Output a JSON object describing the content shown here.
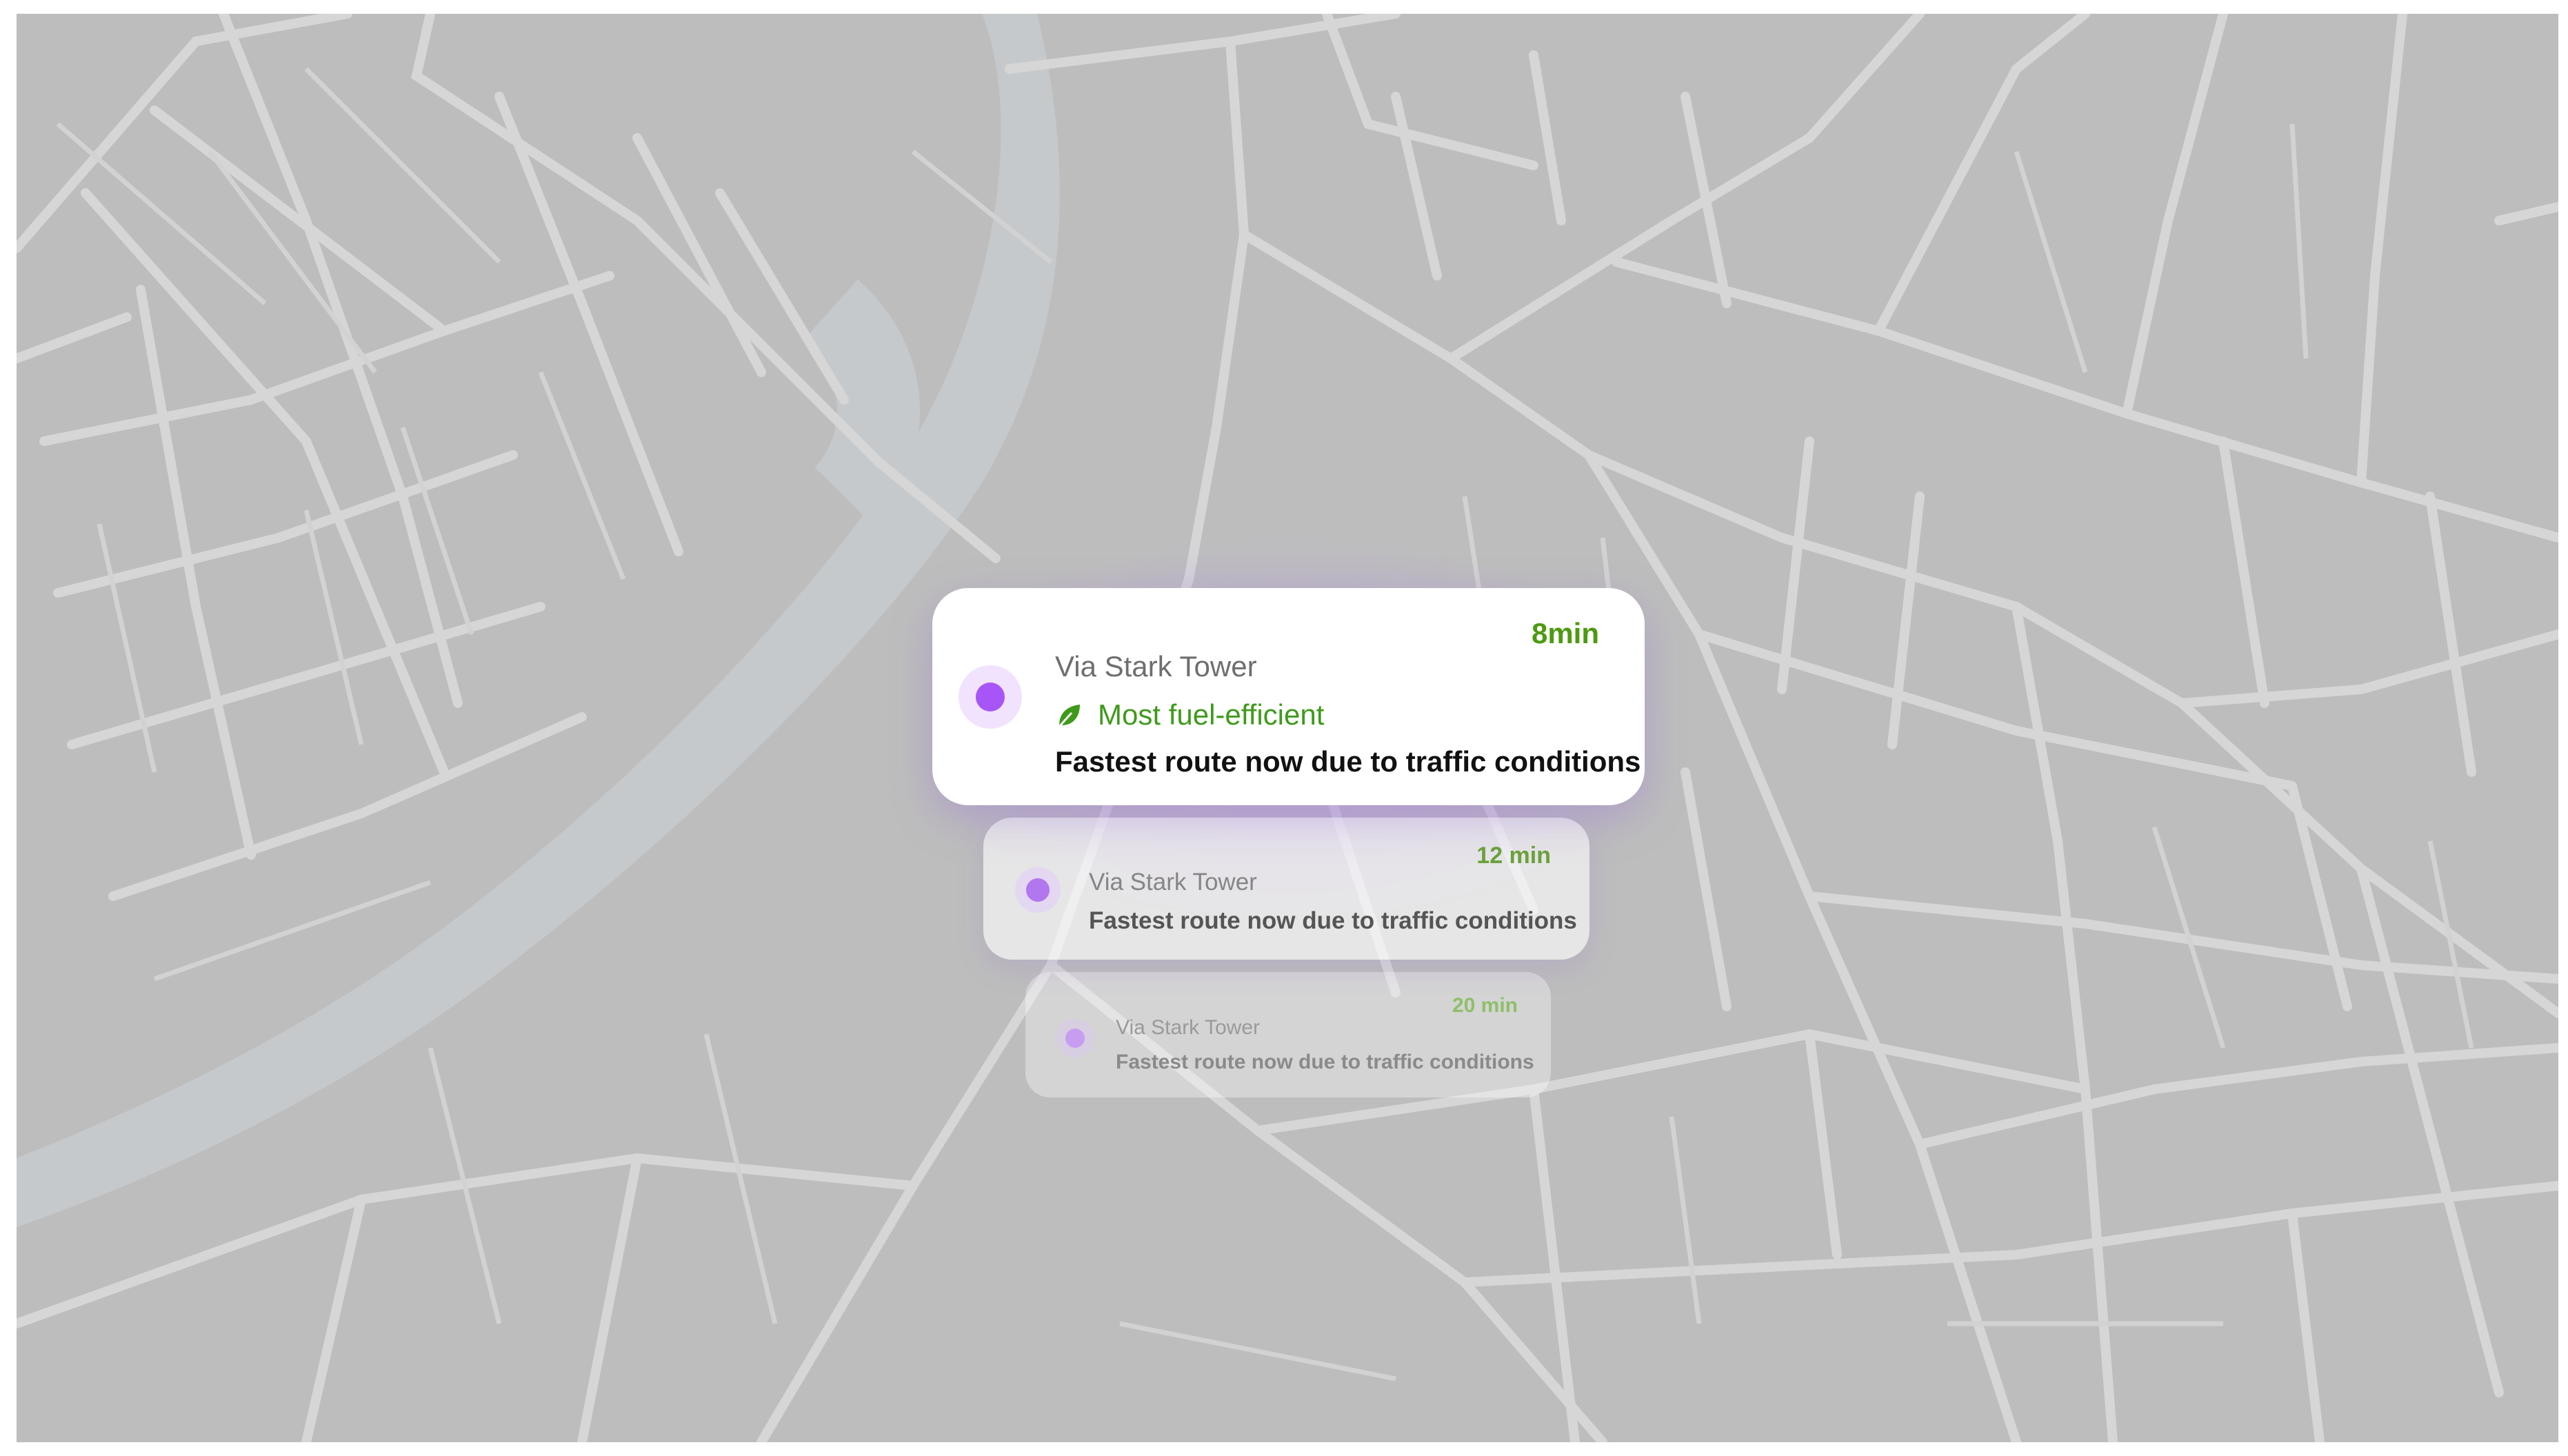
{
  "colors": {
    "map_background": "#bdbdbd",
    "road": "#d9d9d9",
    "river": "#c5c8cb",
    "accent_purple": "#a855f7",
    "time_green": "#4d9a12",
    "eco_green": "#3f9a1c"
  },
  "routes": [
    {
      "duration": "8min",
      "name": "Via Stark Tower",
      "tag_icon": "leaf-icon",
      "tag": "Most fuel-efficient",
      "description": "Fastest route now due to traffic conditions"
    },
    {
      "duration": "12 min",
      "name": "Via Stark Tower",
      "description": "Fastest route now due to traffic conditions"
    },
    {
      "duration": "20 min",
      "name": "Via Stark Tower",
      "description": "Fastest route now due to traffic conditions"
    }
  ]
}
